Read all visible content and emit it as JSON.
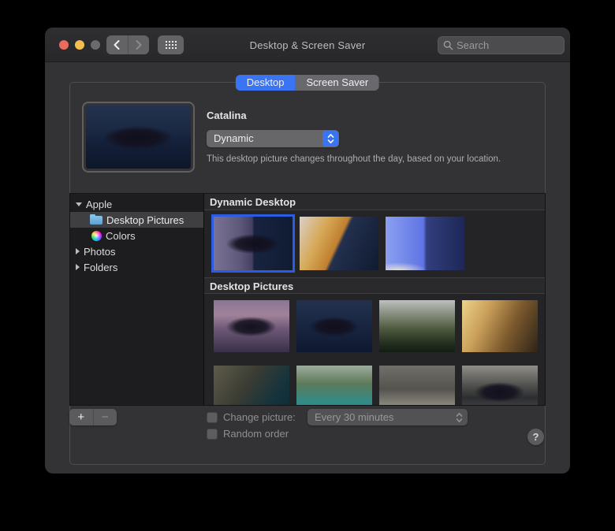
{
  "window": {
    "title": "Desktop & Screen Saver"
  },
  "titlebar": {
    "search_placeholder": "Search"
  },
  "tabs": [
    {
      "label": "Desktop",
      "active": true
    },
    {
      "label": "Screen Saver",
      "active": false
    }
  ],
  "preview": {
    "title": "Catalina",
    "mode": "Dynamic",
    "description": "This desktop picture changes throughout the day, based on your location."
  },
  "sidebar": {
    "items": [
      {
        "label": "Apple",
        "expanded": true
      },
      {
        "label": "Desktop Pictures",
        "selected": true
      },
      {
        "label": "Colors"
      },
      {
        "label": "Photos",
        "expanded": false
      },
      {
        "label": "Folders",
        "expanded": false
      }
    ]
  },
  "sections": {
    "dynamic_header": "Dynamic Desktop",
    "pictures_header": "Desktop Pictures"
  },
  "footer": {
    "add_label": "+",
    "remove_label": "−",
    "change_picture_label": "Change picture:",
    "interval_value": "Every 30 minutes",
    "random_order_label": "Random order",
    "help_label": "?"
  },
  "colors": {
    "accent_blue": "#3b74f2",
    "selection_border": "#2b5ce2",
    "tab_active": "#3b74f2"
  }
}
